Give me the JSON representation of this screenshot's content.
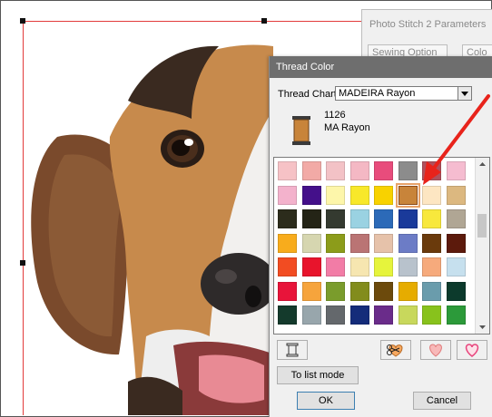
{
  "background_dialog": {
    "title": "Photo Stitch 2 Parameters",
    "tabs": [
      "Sewing Option",
      "Colo"
    ]
  },
  "dialog": {
    "title": "Thread Color",
    "chart_label": "Thread Chart:",
    "chart_value": "MADEIRA Rayon",
    "thread_code": "1126",
    "thread_name": "MA Rayon",
    "spool_color": "#c8843a",
    "list_mode_label": "To list mode",
    "ok_label": "OK",
    "cancel_label": "Cancel"
  },
  "swatches": [
    [
      "#f6c2c6",
      "#f2aaa6",
      "#f3c2c6",
      "#f4b8c4",
      "#e84c7c",
      "#8c8c8c",
      "#b0505c",
      "#f5bcd0"
    ],
    [
      "#f3b2cc",
      "#44108a",
      "#fdf6aa",
      "#f8e82a",
      "#f8d200",
      "#c8843a",
      "#fde6c2",
      "#dcb880"
    ],
    [
      "#2c2c1c",
      "#242416",
      "#343a30",
      "#9ad2e2",
      "#2c6ab8",
      "#1a3a9a",
      "#f8e83c",
      "#b0a694"
    ],
    [
      "#f8ac1c",
      "#d6d6b0",
      "#8c9c1a",
      "#ba7474",
      "#e6c2aa",
      "#6c7cc6",
      "#6a3a0c",
      "#5c1a0c"
    ],
    [
      "#f24c22",
      "#e8142c",
      "#f27ca6",
      "#f6e6b0",
      "#e6f43c",
      "#b8c2cc",
      "#f6aa7c",
      "#c6e0ee"
    ],
    [
      "#e8143a",
      "#f6a43c",
      "#7a9c2c",
      "#828c1c",
      "#6c4a0c",
      "#e6ac00",
      "#6a9cac",
      "#0c3a2c"
    ],
    [
      "#143a2c",
      "#98a6ac",
      "#64686c",
      "#142c7a",
      "#6a2c8a",
      "#c8d85c",
      "#88c21c",
      "#2c9a3a"
    ]
  ],
  "selected_swatch": {
    "row": 1,
    "col": 5
  },
  "icons": {
    "spool": "thread-spool-icon",
    "scroll_up": "chevron-up-icon",
    "scroll_down": "chevron-down-icon",
    "tool_left": "spool-outline-icon",
    "tool_1": "scissors-heart-icon",
    "tool_2": "heart-icon",
    "tool_3": "heart-outline-icon"
  },
  "colors": {
    "selection_frame": "#e23b3b",
    "annotation_arrow": "#e8231b",
    "titlebar": "#6e6e6e"
  }
}
